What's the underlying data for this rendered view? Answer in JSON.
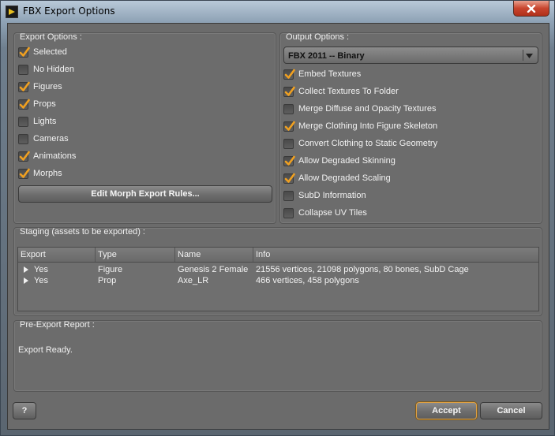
{
  "window": {
    "title": "FBX Export Options",
    "close_label": "x"
  },
  "export_options": {
    "title": "Export Options :",
    "items": [
      {
        "label": "Selected",
        "checked": true
      },
      {
        "label": "No Hidden",
        "checked": false
      },
      {
        "label": "Figures",
        "checked": true
      },
      {
        "label": "Props",
        "checked": true
      },
      {
        "label": "Lights",
        "checked": false
      },
      {
        "label": "Cameras",
        "checked": false
      },
      {
        "label": "Animations",
        "checked": true
      },
      {
        "label": "Morphs",
        "checked": true
      }
    ],
    "morph_button": "Edit Morph Export Rules..."
  },
  "output_options": {
    "title": "Output Options :",
    "format": "FBX 2011 -- Binary",
    "items": [
      {
        "label": "Embed Textures",
        "checked": true
      },
      {
        "label": "Collect Textures To Folder",
        "checked": true
      },
      {
        "label": "Merge Diffuse and Opacity Textures",
        "checked": false
      },
      {
        "label": "Merge Clothing Into Figure Skeleton",
        "checked": true
      },
      {
        "label": "Convert Clothing to Static Geometry",
        "checked": false
      },
      {
        "label": "Allow Degraded Skinning",
        "checked": true
      },
      {
        "label": "Allow Degraded Scaling",
        "checked": true
      },
      {
        "label": "SubD Information",
        "checked": false
      },
      {
        "label": "Collapse UV Tiles",
        "checked": false
      }
    ]
  },
  "staging": {
    "title": "Staging (assets to be exported) :",
    "columns": [
      "Export",
      "Type",
      "Name",
      "Info"
    ],
    "rows": [
      {
        "export": "Yes",
        "type": "Figure",
        "name": "Genesis 2 Female",
        "info": "21556 vertices, 21098 polygons, 80 bones, SubD Cage"
      },
      {
        "export": "Yes",
        "type": "Prop",
        "name": "Axe_LR",
        "info": "466 vertices, 458 polygons"
      }
    ]
  },
  "report": {
    "title": "Pre-Export Report :",
    "text": "Export Ready."
  },
  "buttons": {
    "help": "?",
    "accept": "Accept",
    "cancel": "Cancel"
  },
  "colors": {
    "check": "#f0a020",
    "accept_border": "#e0a040"
  }
}
